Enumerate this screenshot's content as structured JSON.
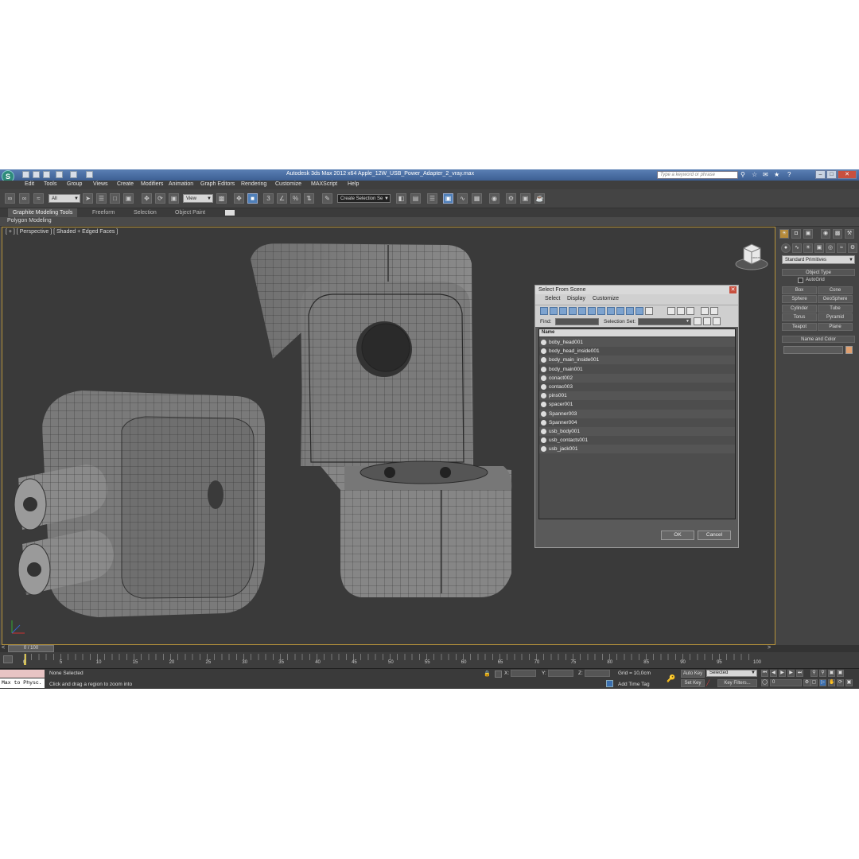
{
  "window": {
    "title": "Autodesk 3ds Max  2012 x64       Apple_12W_USB_Power_Adapter_2_vray.max",
    "search_placeholder": "Type a keyword or phrase"
  },
  "menu": [
    "Edit",
    "Tools",
    "Group",
    "Views",
    "Create",
    "Modifiers",
    "Animation",
    "Graph Editors",
    "Rendering",
    "Customize",
    "MAXScript",
    "Help"
  ],
  "toolbar": {
    "filter_value": "All",
    "ref_coord_value": "View",
    "snap_label": "3",
    "selection_set_value": "Create Selection Se"
  },
  "ribbon": {
    "tabs": [
      "Graphite Modeling Tools",
      "Freeform",
      "Selection",
      "Object Paint"
    ],
    "active_sub": "Polygon Modeling"
  },
  "viewport": {
    "label": "[ + ] [ Perspective ] [ Shaded + Edged Faces ]",
    "viewcube_label": "FRONT"
  },
  "command_panel": {
    "category_value": "Standard Primitives",
    "object_type_title": "Object Type",
    "autogrid_label": "AutoGrid",
    "primitives": [
      "Box",
      "Cone",
      "Sphere",
      "GeoSphere",
      "Cylinder",
      "Tube",
      "Torus",
      "Pyramid",
      "Teapot",
      "Plane"
    ],
    "name_color_title": "Name and Color",
    "object_color": "#e0a070"
  },
  "dialog": {
    "title": "Select From Scene",
    "menu": [
      "Select",
      "Display",
      "Customize"
    ],
    "find_label": "Find:",
    "selection_set_label": "Selection Set:",
    "column_name": "Name",
    "items": [
      "boby_head001",
      "body_head_inside001",
      "body_main_inside001",
      "body_main001",
      "conact002",
      "contac003",
      "pins001",
      "spacer001",
      "Spanner003",
      "Spanner004",
      "usb_body001",
      "usb_contacts001",
      "usb_jack001"
    ],
    "ok_label": "OK",
    "cancel_label": "Cancel"
  },
  "timeline": {
    "frame_counter": "0 / 100",
    "ticks": [
      "0",
      "5",
      "10",
      "15",
      "20",
      "25",
      "30",
      "35",
      "40",
      "45",
      "50",
      "55",
      "60",
      "65",
      "70",
      "75",
      "80",
      "85",
      "90",
      "95",
      "100"
    ]
  },
  "status": {
    "maxscript_label": "Max to Physc.",
    "selection_text": "None Selected",
    "prompt_text": "Click and drag a region to zoom into",
    "x_label": "X:",
    "y_label": "Y:",
    "z_label": "Z:",
    "grid_text": "Grid = 10,0cm",
    "add_time_tag": "Add Time Tag",
    "auto_key": "Auto Key",
    "set_key": "Set Key",
    "key_mode_value": "Selected",
    "key_filters": "Key Filters...",
    "current_frame": "0"
  }
}
